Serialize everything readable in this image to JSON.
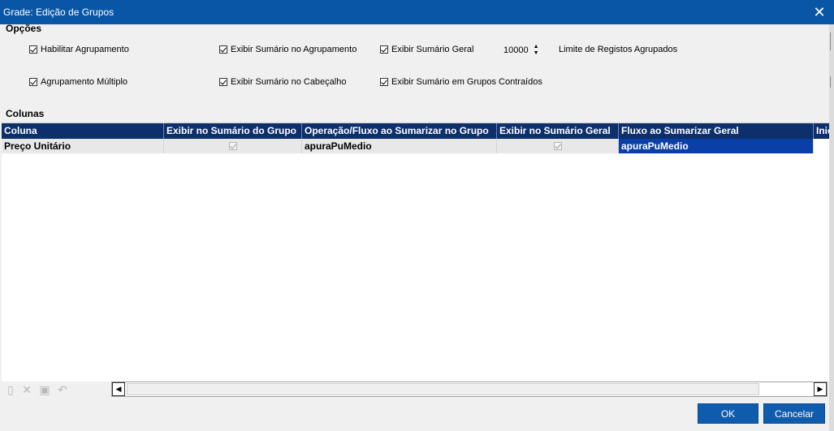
{
  "window": {
    "title": "Grade: Edição de Grupos"
  },
  "options": {
    "heading": "Opções",
    "habilitar_agrupamento": "Habilitar Agrupamento",
    "agrupamento_multiplo": "Agrupamento Múltiplo",
    "exibir_sumario_agrupamento": "Exibir Sumário no Agrupamento",
    "exibir_sumario_cabecalho": "Exibir Sumário no Cabeçalho",
    "exibir_sumario_geral": "Exibir Sumário Geral",
    "exibir_sumario_grupos_contraidos": "Exibir Sumário em Grupos Contraídos",
    "limite_value": "10000",
    "limite_label": "Limite de Registos Agrupados"
  },
  "columns": {
    "heading": "Colunas",
    "headers": [
      "Coluna",
      "Exibir no Sumário do Grupo",
      "Operação/Fluxo ao Sumarizar no Grupo",
      "Exibir no Sumário Geral",
      "Fluxo ao Sumarizar Geral",
      "Inic"
    ],
    "rows": [
      {
        "coluna": "Preço Unitário",
        "exibir_sumario_grupo": true,
        "operacao": "apuraPuMedio",
        "exibir_sumario_geral": true,
        "fluxo_geral": "apuraPuMedio"
      }
    ]
  },
  "buttons": {
    "ok": "OK",
    "cancel": "Cancelar"
  },
  "colors": {
    "titlebar": "#0a56a6",
    "grid_header": "#0d2f6b",
    "selection": "#0a3fa8",
    "button": "#0f5cad"
  }
}
